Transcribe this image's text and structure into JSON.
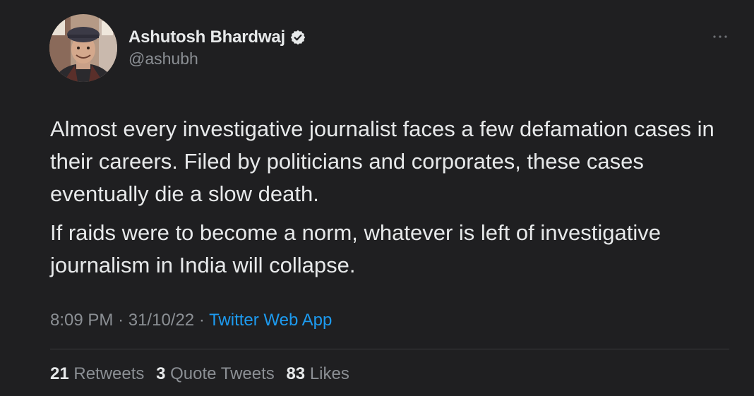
{
  "author": {
    "display_name": "Ashutosh Bhardwaj",
    "handle": "@ashubh",
    "verified": true
  },
  "tweet": {
    "paragraphs": [
      "Almost every investigative journalist faces a few defamation cases in their careers. Filed by politicians and corporates, these cases eventually die a slow death.",
      "If raids were to become a norm, whatever is left of investigative journalism in India will collapse."
    ],
    "time": "8:09 PM",
    "separator": "·",
    "date": "31/10/22",
    "source": "Twitter Web App"
  },
  "stats": {
    "retweets_count": "21",
    "retweets_label": "Retweets",
    "quotes_count": "3",
    "quotes_label": "Quote Tweets",
    "likes_count": "83",
    "likes_label": "Likes"
  },
  "icons": {
    "verified": "verified-badge-icon",
    "more": "more-options-icon"
  },
  "colors": {
    "background": "#1f1f21",
    "text": "#e7e9ea",
    "muted": "#8b8f94",
    "link": "#1d9bf0"
  }
}
